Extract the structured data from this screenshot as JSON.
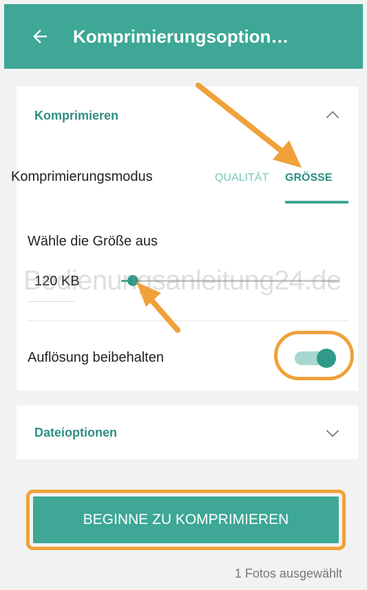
{
  "appbar": {
    "title": "Komprimierungsoption…",
    "back_icon": "arrow-left-icon"
  },
  "compress": {
    "section_title": "Komprimieren",
    "mode_label": "Komprimierungsmodus",
    "tabs": [
      {
        "label": "QUALITÄT",
        "selected": false
      },
      {
        "label": "GRÖSSE",
        "selected": true
      }
    ],
    "size_label": "Wähle die Größe aus",
    "size_value": "120 KB",
    "slider_level": 0.05,
    "watermark": "Bedienungsanleitung24.de",
    "resolution_label": "Auflösung beibehalten",
    "resolution_on": true
  },
  "file_options": {
    "section_title": "Dateioptionen"
  },
  "action": {
    "button_label": "BEGINNE ZU KOMPRIMIEREN"
  },
  "footer": {
    "status": "1 Fotos ausgewählt"
  },
  "colors": {
    "primary": "#3ea796",
    "accent_dark": "#2f8f80",
    "highlight": "#f0a13a"
  }
}
